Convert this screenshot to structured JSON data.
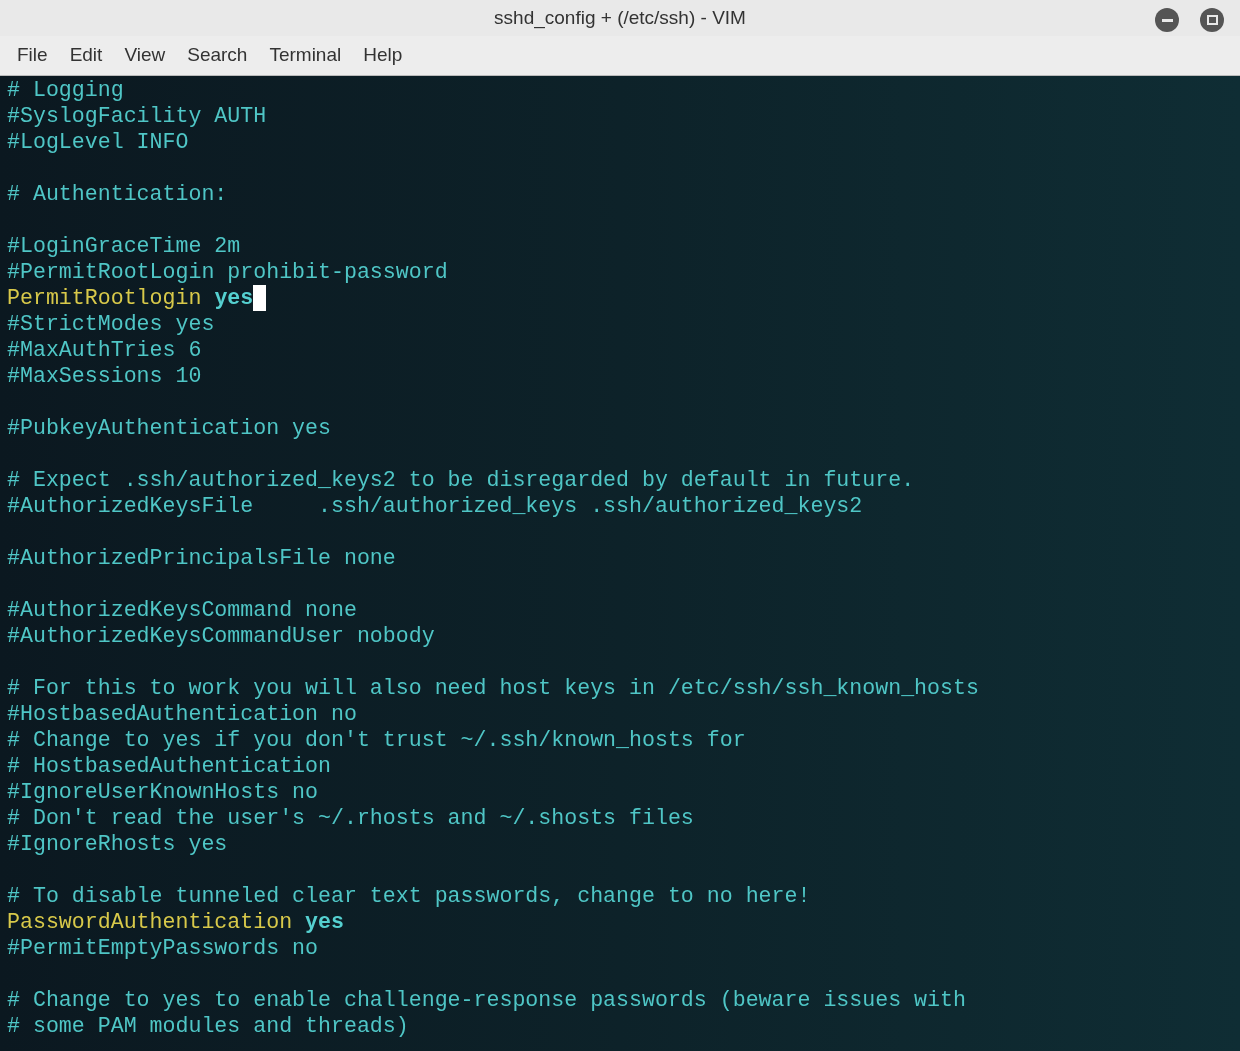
{
  "window": {
    "title": "sshd_config + (/etc/ssh) - VIM"
  },
  "menu": [
    "File",
    "Edit",
    "View",
    "Search",
    "Terminal",
    "Help"
  ],
  "lines": [
    {
      "kind": "comment",
      "text": "# Logging"
    },
    {
      "kind": "comment",
      "text": "#SyslogFacility AUTH"
    },
    {
      "kind": "comment",
      "text": "#LogLevel INFO"
    },
    {
      "kind": "blank"
    },
    {
      "kind": "comment",
      "text": "# Authentication:"
    },
    {
      "kind": "blank"
    },
    {
      "kind": "comment",
      "text": "#LoginGraceTime 2m"
    },
    {
      "kind": "comment",
      "text": "#PermitRootLogin prohibit-password"
    },
    {
      "kind": "directive",
      "keyword": "PermitRootlogin",
      "value": "yes",
      "cursor": true
    },
    {
      "kind": "comment",
      "text": "#StrictModes yes"
    },
    {
      "kind": "comment",
      "text": "#MaxAuthTries 6"
    },
    {
      "kind": "comment",
      "text": "#MaxSessions 10"
    },
    {
      "kind": "blank"
    },
    {
      "kind": "comment",
      "text": "#PubkeyAuthentication yes"
    },
    {
      "kind": "blank"
    },
    {
      "kind": "comment",
      "text": "# Expect .ssh/authorized_keys2 to be disregarded by default in future."
    },
    {
      "kind": "comment",
      "text": "#AuthorizedKeysFile     .ssh/authorized_keys .ssh/authorized_keys2"
    },
    {
      "kind": "blank"
    },
    {
      "kind": "comment",
      "text": "#AuthorizedPrincipalsFile none"
    },
    {
      "kind": "blank"
    },
    {
      "kind": "comment",
      "text": "#AuthorizedKeysCommand none"
    },
    {
      "kind": "comment",
      "text": "#AuthorizedKeysCommandUser nobody"
    },
    {
      "kind": "blank"
    },
    {
      "kind": "comment",
      "text": "# For this to work you will also need host keys in /etc/ssh/ssh_known_hosts"
    },
    {
      "kind": "comment",
      "text": "#HostbasedAuthentication no"
    },
    {
      "kind": "comment",
      "text": "# Change to yes if you don't trust ~/.ssh/known_hosts for"
    },
    {
      "kind": "comment",
      "text": "# HostbasedAuthentication"
    },
    {
      "kind": "comment",
      "text": "#IgnoreUserKnownHosts no"
    },
    {
      "kind": "comment",
      "text": "# Don't read the user's ~/.rhosts and ~/.shosts files"
    },
    {
      "kind": "comment",
      "text": "#IgnoreRhosts yes"
    },
    {
      "kind": "blank"
    },
    {
      "kind": "comment",
      "text": "# To disable tunneled clear text passwords, change to no here!"
    },
    {
      "kind": "directive",
      "keyword": "PasswordAuthentication",
      "value": "yes",
      "cursor": false
    },
    {
      "kind": "comment",
      "text": "#PermitEmptyPasswords no"
    },
    {
      "kind": "blank"
    },
    {
      "kind": "comment",
      "text": "# Change to yes to enable challenge-response passwords (beware issues with"
    },
    {
      "kind": "comment",
      "text": "# some PAM modules and threads)"
    }
  ]
}
